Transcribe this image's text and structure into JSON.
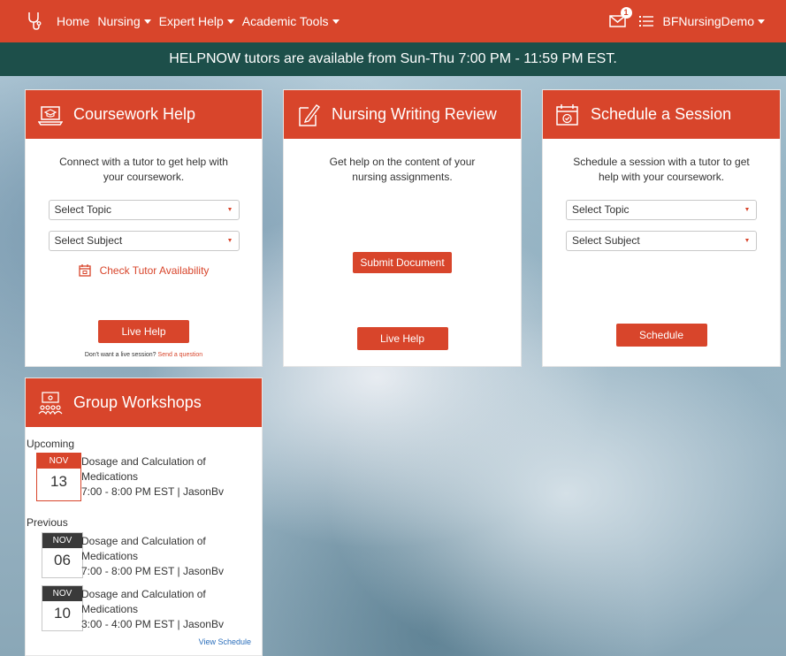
{
  "nav": {
    "links": [
      {
        "label": "Home",
        "caret": false
      },
      {
        "label": "Nursing",
        "caret": true
      },
      {
        "label": "Expert Help",
        "caret": true
      },
      {
        "label": "Academic Tools",
        "caret": true
      }
    ],
    "notification_count": "1",
    "user": "BFNursingDemo"
  },
  "banner": "HELPNOW tutors are available from Sun-Thu 7:00 PM - 11:59 PM EST.",
  "coursework": {
    "title": "Coursework Help",
    "desc": "Connect with a tutor to get help with your coursework.",
    "topic_placeholder": "Select Topic",
    "subject_placeholder": "Select Subject",
    "availability": "Check Tutor Availability",
    "live_help": "Live Help",
    "footer_text": "Don't want a live session?",
    "footer_link": "Send a question"
  },
  "writing": {
    "title": "Nursing Writing Review",
    "desc": "Get help on the content of your nursing assignments.",
    "submit": "Submit Document",
    "live_help": "Live Help"
  },
  "schedule": {
    "title": "Schedule a Session",
    "desc": "Schedule a session with a tutor to get help with your coursework.",
    "topic_placeholder": "Select Topic",
    "subject_placeholder": "Select Subject",
    "button": "Schedule"
  },
  "workshops": {
    "title": "Group Workshops",
    "upcoming_label": "Upcoming",
    "previous_label": "Previous",
    "upcoming": [
      {
        "month": "NOV",
        "day": "13",
        "title_line1": "Dosage and Calculation of",
        "title_line2": "Medications",
        "time": "7:00 - 8:00 PM EST | JasonBv"
      }
    ],
    "previous": [
      {
        "month": "NOV",
        "day": "06",
        "title_line1": "Dosage and Calculation of",
        "title_line2": "Medications",
        "time": "7:00 - 8:00 PM EST | JasonBv"
      },
      {
        "month": "NOV",
        "day": "10",
        "title_line1": "Dosage and Calculation of",
        "title_line2": "Medications",
        "time": "3:00 - 4:00 PM EST | JasonBv"
      }
    ],
    "view_schedule": "View Schedule"
  },
  "colors": {
    "brand": "#d8452b",
    "banner": "#1d4f4a",
    "prev_month": "#3a3a3a"
  }
}
